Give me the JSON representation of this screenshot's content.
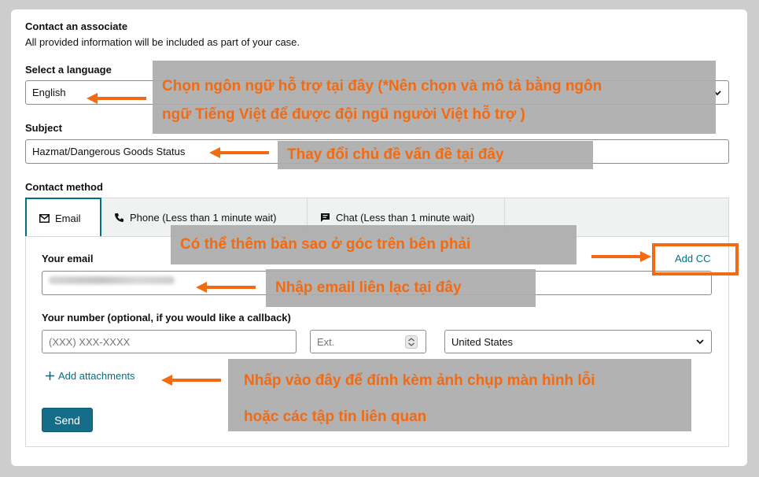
{
  "header": {
    "title": "Contact an associate",
    "subtitle": "All provided information will be included as part of your case."
  },
  "language": {
    "label": "Select a language",
    "value": "English"
  },
  "subject": {
    "label": "Subject",
    "value": "Hazmat/Dangerous Goods Status"
  },
  "contact": {
    "label": "Contact method",
    "tabs": [
      {
        "label": "Email",
        "icon": "mail-icon"
      },
      {
        "label": "Phone (Less than 1 minute wait)",
        "icon": "phone-icon"
      },
      {
        "label": "Chat (Less than 1 minute wait)",
        "icon": "chat-icon"
      }
    ]
  },
  "email": {
    "label": "Your email",
    "add_cc": "Add CC",
    "value_obscured": true
  },
  "phone": {
    "label": "Your number (optional, if you would like a callback)",
    "number_placeholder": "(XXX) XXX-XXXX",
    "ext_placeholder": "Ext.",
    "country": "United States"
  },
  "attachments": {
    "label": "Add attachments"
  },
  "send_label": "Send",
  "annotations": {
    "language_line1": "Chọn ngôn ngữ hỗ trợ tại đây (*Nên chọn và mô tả bằng ngôn",
    "language_line2": "ngữ Tiếng Việt để được đội ngũ người Việt hỗ trợ )",
    "subject": "Thay đổi chủ đề vấn đề tại đây",
    "cc": "Có thể thêm bản sao ở góc trên bên phải",
    "email": "Nhập email liên lạc tại đây",
    "attach_line1": "Nhấp vào đây để đính kèm ảnh chụp màn hình lỗi",
    "attach_line2": "hoặc các tập tin liên quan"
  },
  "colors": {
    "accent": "#007185",
    "send": "#146e8a",
    "annotation_text": "#f26a12",
    "arrow": "#f26a12",
    "annotation_bg": "#ababab"
  }
}
